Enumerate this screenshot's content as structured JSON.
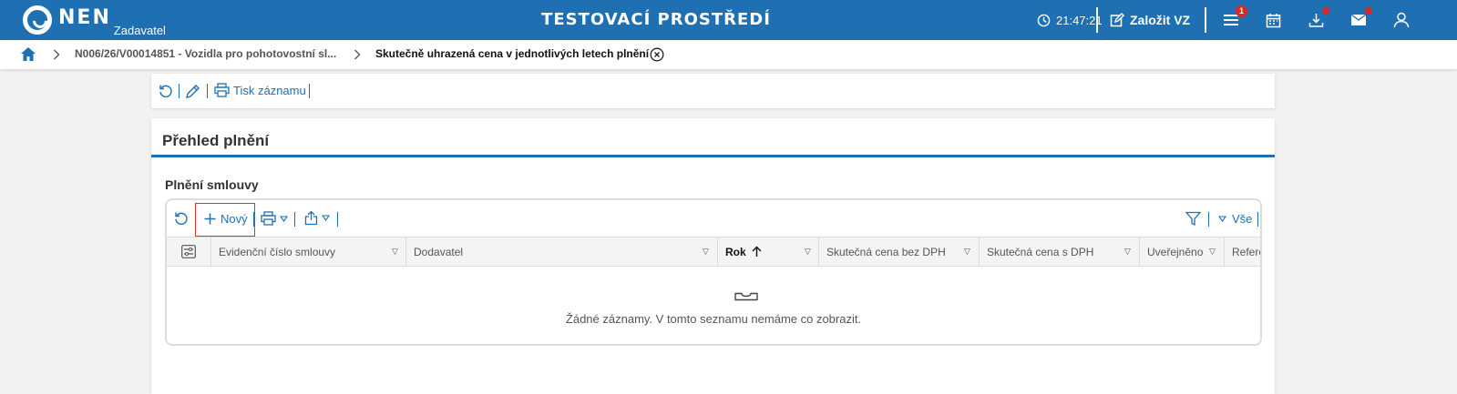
{
  "header": {
    "logo_text": "NEN",
    "logo_sub": "Zadavatel",
    "environment": "TESTOVACÍ PROSTŘEDÍ",
    "time": "21:47:21",
    "create_label": "Založit VZ",
    "menu_badge": "1",
    "icons": [
      "clock-icon",
      "edit-icon",
      "menu-icon",
      "calendar-icon",
      "download-icon",
      "mail-icon",
      "user-icon"
    ]
  },
  "breadcrumb": {
    "items": [
      "N006/26/V00014851 - Vozidla pro pohotovostní sl...",
      "Skutečně uhrazená cena v jednotlivých letech plnění"
    ]
  },
  "toolbar": {
    "print_label": "Tisk záznamu"
  },
  "section": {
    "title": "Přehled plnění",
    "subtitle": "Plnění smlouvy"
  },
  "grid": {
    "new_label": "Nový",
    "filter_all": "Vše",
    "columns": [
      "Evidenční číslo smlouvy",
      "Dodavatel",
      "Rok",
      "Skutečná cena bez DPH",
      "Skutečná cena s DPH",
      "Uveřejněno",
      "Refere"
    ],
    "sorted_column": "Rok",
    "empty_message": "Žádné záznamy. V tomto seznamu nemáme co zobrazit."
  },
  "colors": {
    "brand": "#1f6fb3",
    "badge": "#e02424",
    "highlight": "#e23030"
  }
}
